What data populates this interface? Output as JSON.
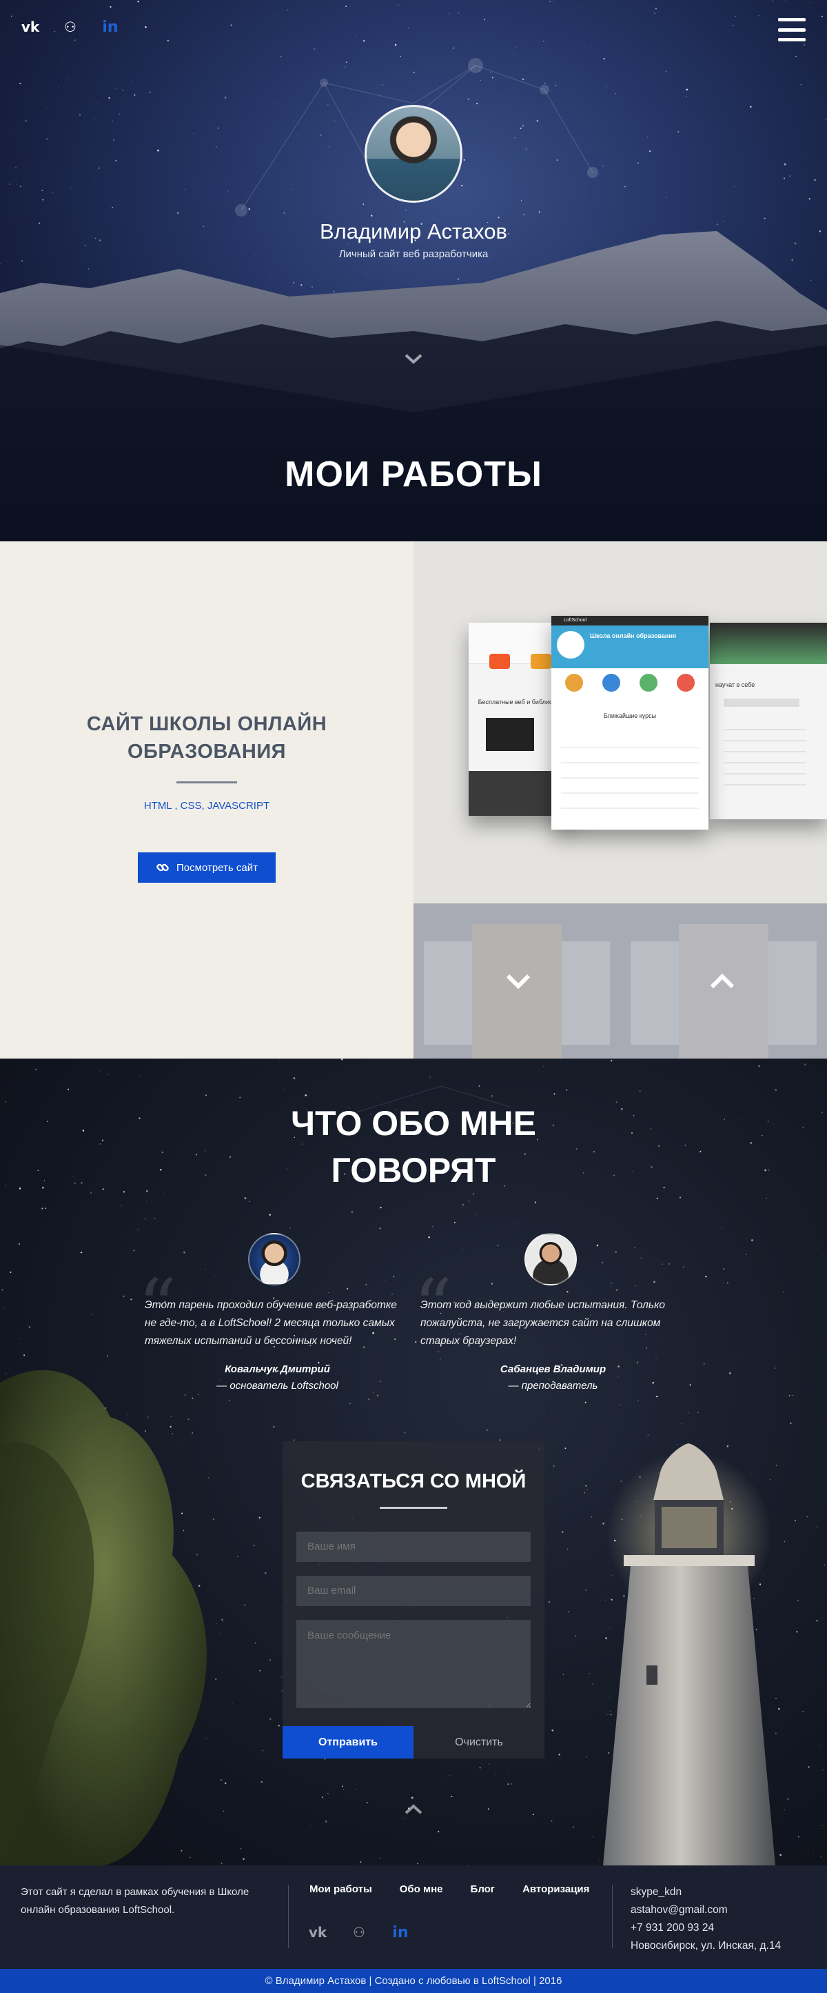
{
  "header": {
    "socials": [
      {
        "name": "vk",
        "label": "vk"
      },
      {
        "name": "github",
        "label": "⚇"
      },
      {
        "name": "linkedin",
        "label": "in"
      }
    ],
    "name": "Владимир Астахов",
    "subtitle": "Личный сайт веб разработчика"
  },
  "works": {
    "section_title": "МОИ РАБОТЫ",
    "project_title_line1": "САЙТ ШКОЛЫ ОНЛАЙН",
    "project_title_line2": "ОБРАЗОВАНИЯ",
    "tech": "HTML , CSS, JAVASCRIPT",
    "button_label": "Посмотреть сайт",
    "mock": {
      "brand": "LoftSchool",
      "hero_title": "Школа онлайн образования",
      "courses_title": "Ближайшие курсы",
      "left_title": "Бесплатные веб и библиотека к",
      "right_title": "научат в себе"
    }
  },
  "testimonials": {
    "title_line1": "ЧТО ОБО МНЕ",
    "title_line2": "ГОВОРЯТ",
    "items": [
      {
        "text": "Этот парень проходил обучение веб-разработке не где-то, а в LoftSchool! 2 месяца только самых тяжелых испытаний и бессонных ночей!",
        "author": "Ковальчук Дмитрий",
        "role": "— основатель Loftschool"
      },
      {
        "text": "Этот код выдержит любые испытания. Только пожалуйста, не загружается сайт на слишком старых браузерах!",
        "author": "Сабанцев Владимир",
        "role": "— преподаватель"
      }
    ]
  },
  "contact": {
    "title": "СВЯЗАТЬСЯ СО МНОЙ",
    "name_placeholder": "Ваше имя",
    "email_placeholder": "Ваш email",
    "message_placeholder": "Ваше сообщение",
    "send_label": "Отправить",
    "clear_label": "Очистить"
  },
  "footer": {
    "about": "Этот сайт я сделал в рамках обучения в Школе онлайн образования LoftSchool.",
    "nav": [
      "Мои работы",
      "Обо мне",
      "Блог",
      "Авторизация"
    ],
    "skype": "skype_kdn",
    "email": "astahov@gmail.com",
    "phone": "+7 931 200 93 24",
    "address": "Новосибирск, ул. Инская, д.14",
    "copyright": "© Владимир Астахов | Создано с любовью в LoftSchool | 2016"
  },
  "colors": {
    "accent": "#0f4ed1",
    "works_bg": "#f1eee8",
    "footer_bg": "#1b2030",
    "copyright_bg": "#0d45b8"
  },
  "icons": [
    "vk-icon",
    "github-icon",
    "linkedin-icon",
    "menu-icon",
    "chevron-down-icon",
    "link-icon",
    "chevron-up-icon",
    "quote-icon"
  ]
}
